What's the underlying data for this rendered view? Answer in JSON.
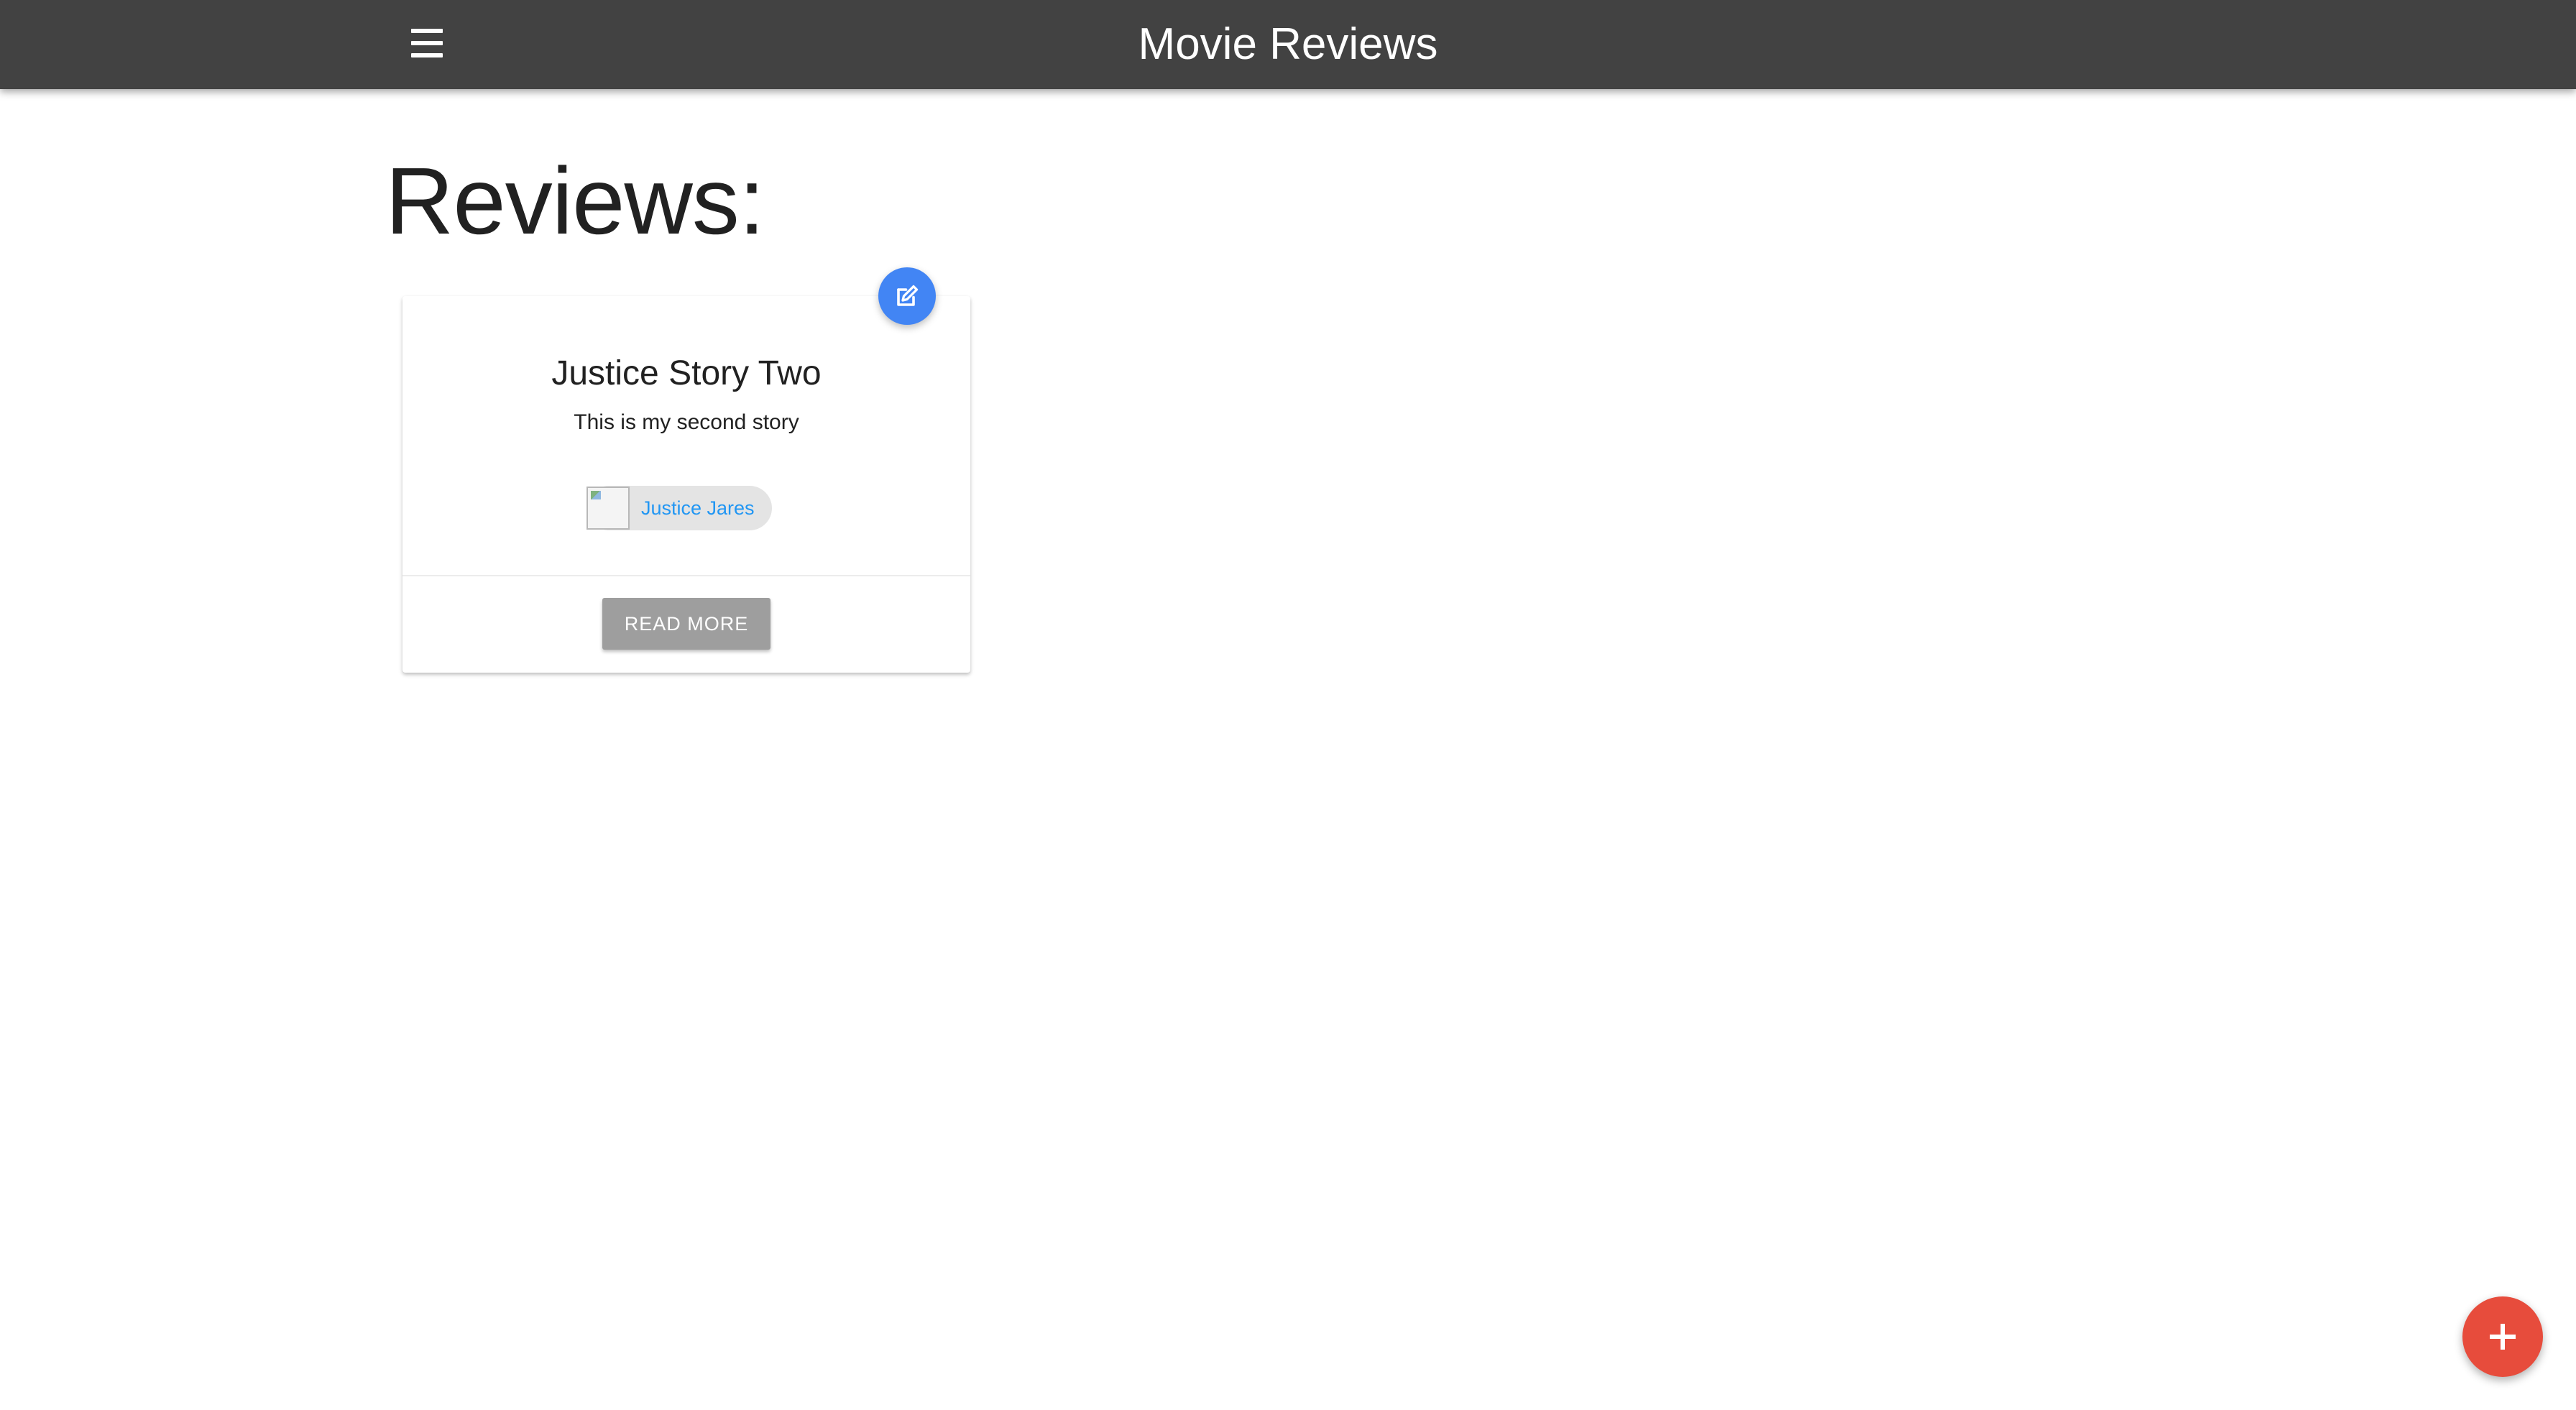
{
  "navbar": {
    "brand": "Movie Reviews",
    "menu_icon": "hamburger-menu-icon"
  },
  "main": {
    "title": "Reviews:"
  },
  "reviews": [
    {
      "title": "Justice Story Two",
      "text": "This is my second story",
      "author": "Justice Jares",
      "action_label": "READ MORE",
      "edit_icon": "edit-icon"
    }
  ],
  "fab": {
    "icon": "plus-icon"
  },
  "colors": {
    "navbar": "#424242",
    "edit_fab": "#4285f4",
    "add_fab": "#e74c3c",
    "link": "#2196f3",
    "button": "#9e9e9e"
  }
}
